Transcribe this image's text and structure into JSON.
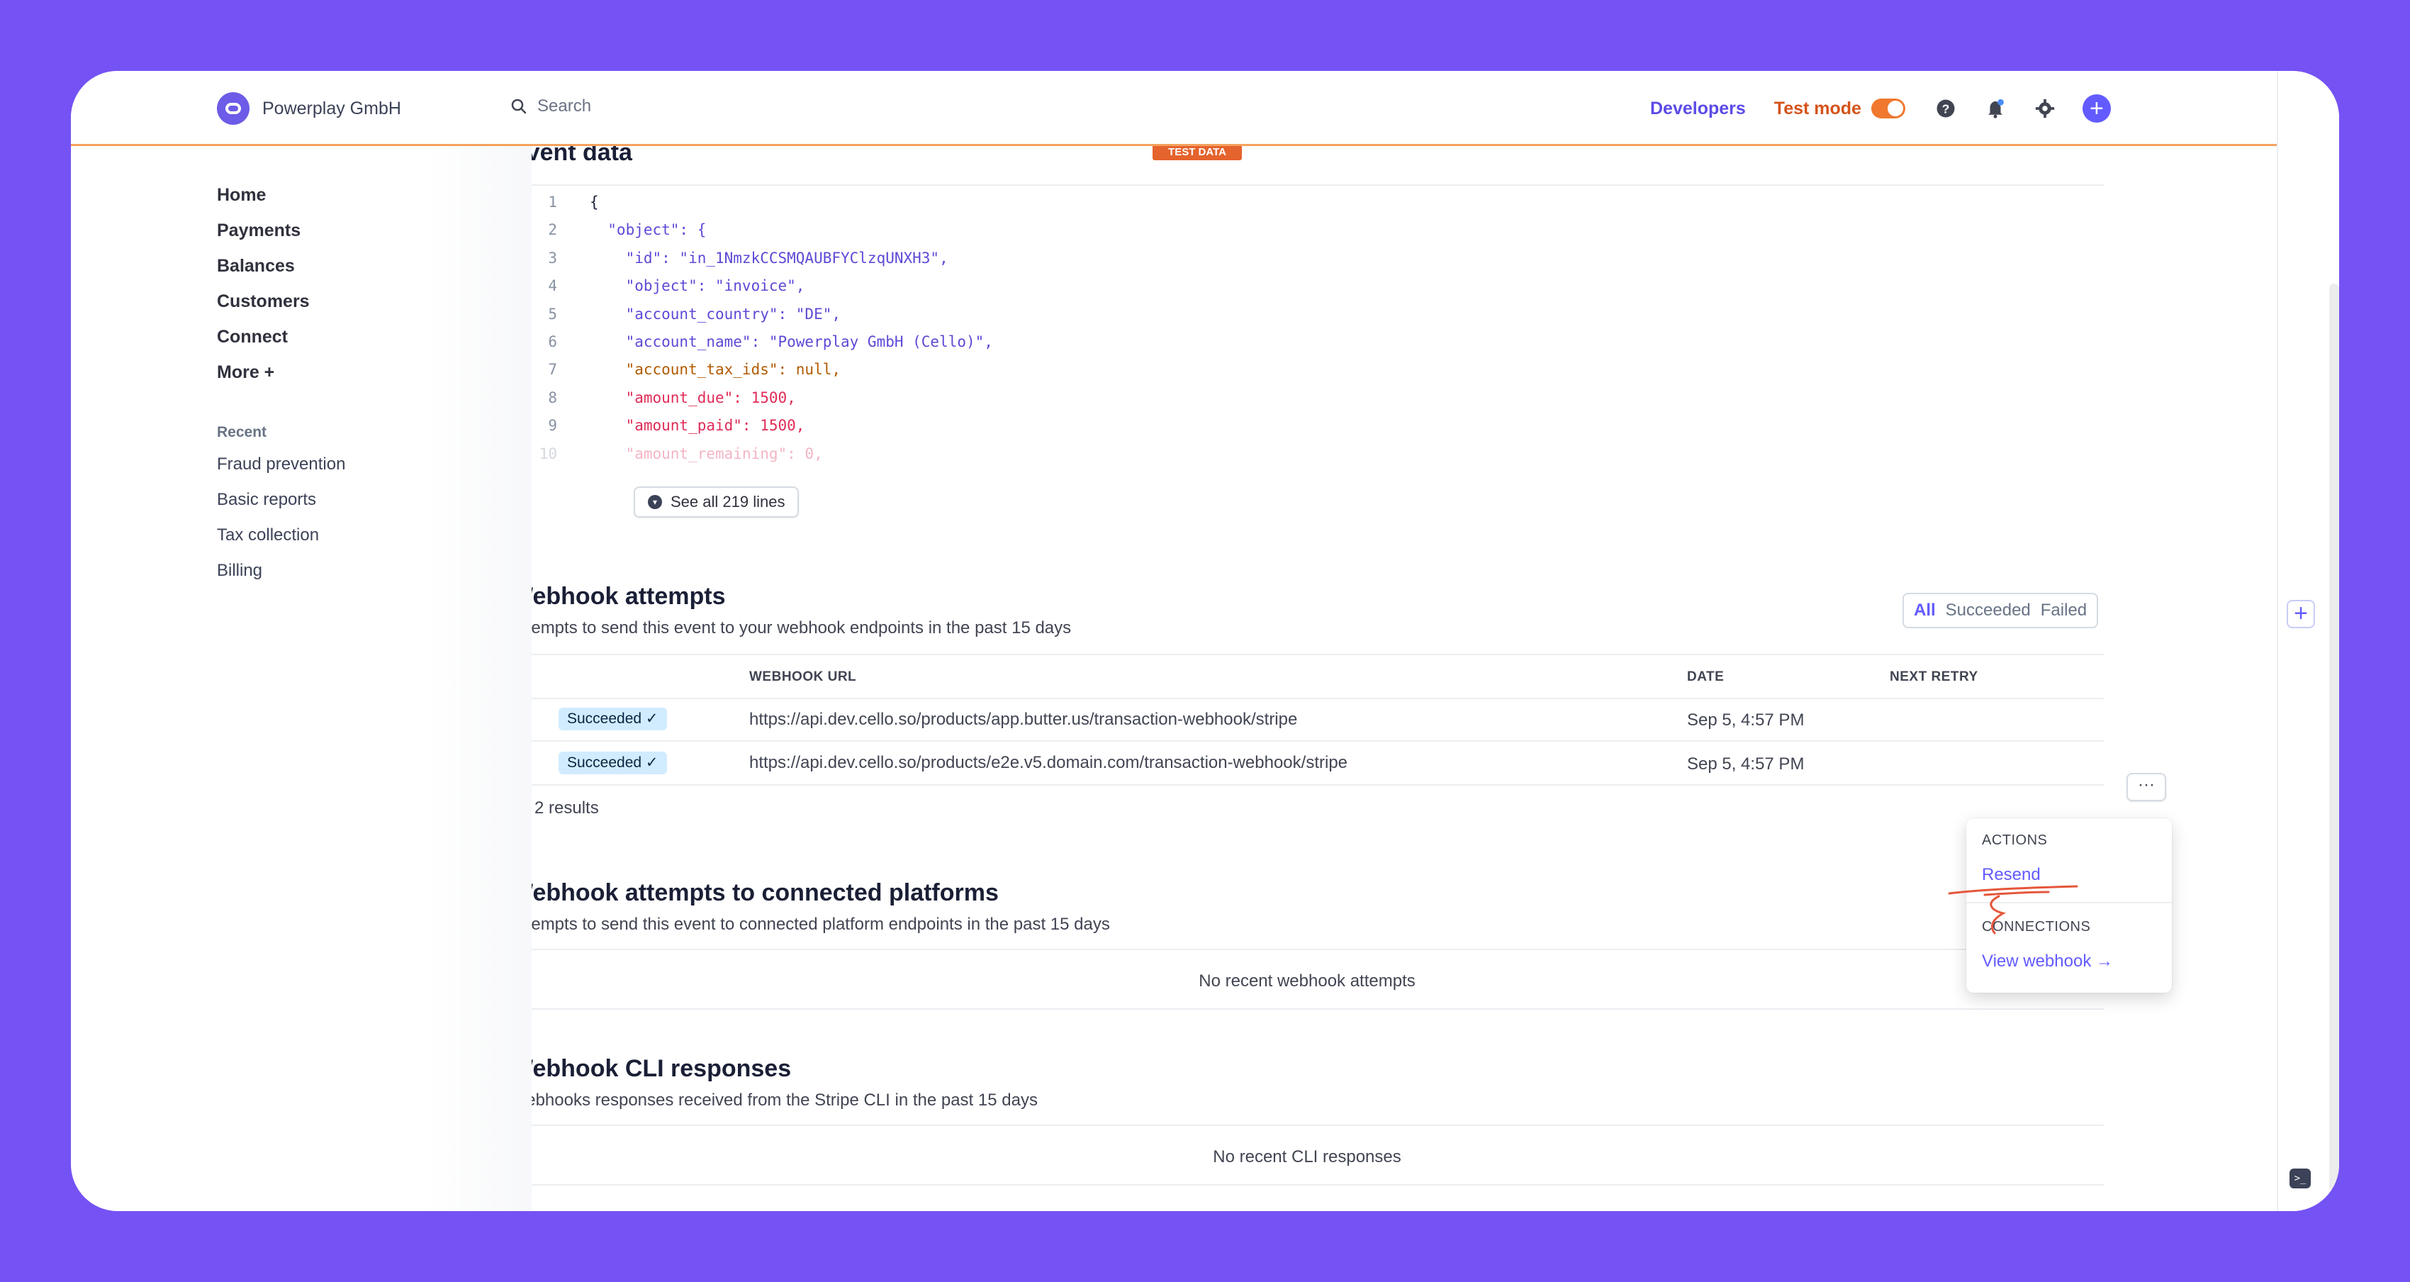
{
  "header": {
    "brand": "Powerplay GmbH",
    "search_placeholder": "Search",
    "developers": "Developers",
    "test_mode": "Test mode"
  },
  "sidebar": {
    "items": [
      "Home",
      "Payments",
      "Balances",
      "Customers",
      "Connect",
      "More +"
    ],
    "recent_label": "Recent",
    "recent": [
      "Fraud prevention",
      "Basic reports",
      "Tax collection",
      "Billing"
    ]
  },
  "event_data": {
    "title": "Event data",
    "badge": "TEST DATA",
    "lines": [
      {
        "n": "1",
        "t": "{"
      },
      {
        "n": "2",
        "t": "  \"object\": {"
      },
      {
        "n": "3",
        "t": "    \"id\": \"in_1NmzkCCSMQAUBFYClzqUNXH3\","
      },
      {
        "n": "4",
        "t": "    \"object\": \"invoice\","
      },
      {
        "n": "5",
        "t": "    \"account_country\": \"DE\","
      },
      {
        "n": "6",
        "t": "    \"account_name\": \"Powerplay GmbH (Cello)\","
      },
      {
        "n": "7",
        "t": "    \"account_tax_ids\": null,"
      },
      {
        "n": "8",
        "t": "    \"amount_due\": 1500,"
      },
      {
        "n": "9",
        "t": "    \"amount_paid\": 1500,"
      },
      {
        "n": "10",
        "t": "    \"amount_remaining\": 0,"
      }
    ],
    "see_all": "See all 219 lines"
  },
  "webhook_attempts": {
    "title": "Webhook attempts",
    "subtitle": "Attempts to send this event to your webhook endpoints in the past 15 days",
    "filters": {
      "all": "All",
      "succeeded": "Succeeded",
      "failed": "Failed"
    },
    "columns": {
      "url": "WEBHOOK URL",
      "date": "DATE",
      "retry": "NEXT RETRY"
    },
    "rows": [
      {
        "status": "Succeeded ✓",
        "url": "https://api.dev.cello.so/products/app.butter.us/transaction-webhook/stripe",
        "date": "Sep 5, 4:57 PM"
      },
      {
        "status": "Succeeded ✓",
        "url": "https://api.dev.cello.so/products/e2e.v5.domain.com/transaction-webhook/stripe",
        "date": "Sep 5, 4:57 PM"
      }
    ],
    "results": "2 results",
    "more": "···"
  },
  "dropdown": {
    "actions_label": "ACTIONS",
    "resend": "Resend",
    "connections_label": "CONNECTIONS",
    "view_webhook": "View webhook →"
  },
  "connected": {
    "title": "Webhook attempts to connected platforms",
    "subtitle": "Attempts to send this event to connected platform endpoints in the past 15 days",
    "empty": "No recent webhook attempts"
  },
  "cli": {
    "title": "Webhook CLI responses",
    "subtitle": "Webhooks responses received from the Stripe CLI in the past 15 days",
    "empty": "No recent CLI responses"
  },
  "colors": {
    "background": "#7552f3",
    "accent": "#635bff",
    "test_mode": "#e5632d",
    "annotation": "#e5563a"
  }
}
